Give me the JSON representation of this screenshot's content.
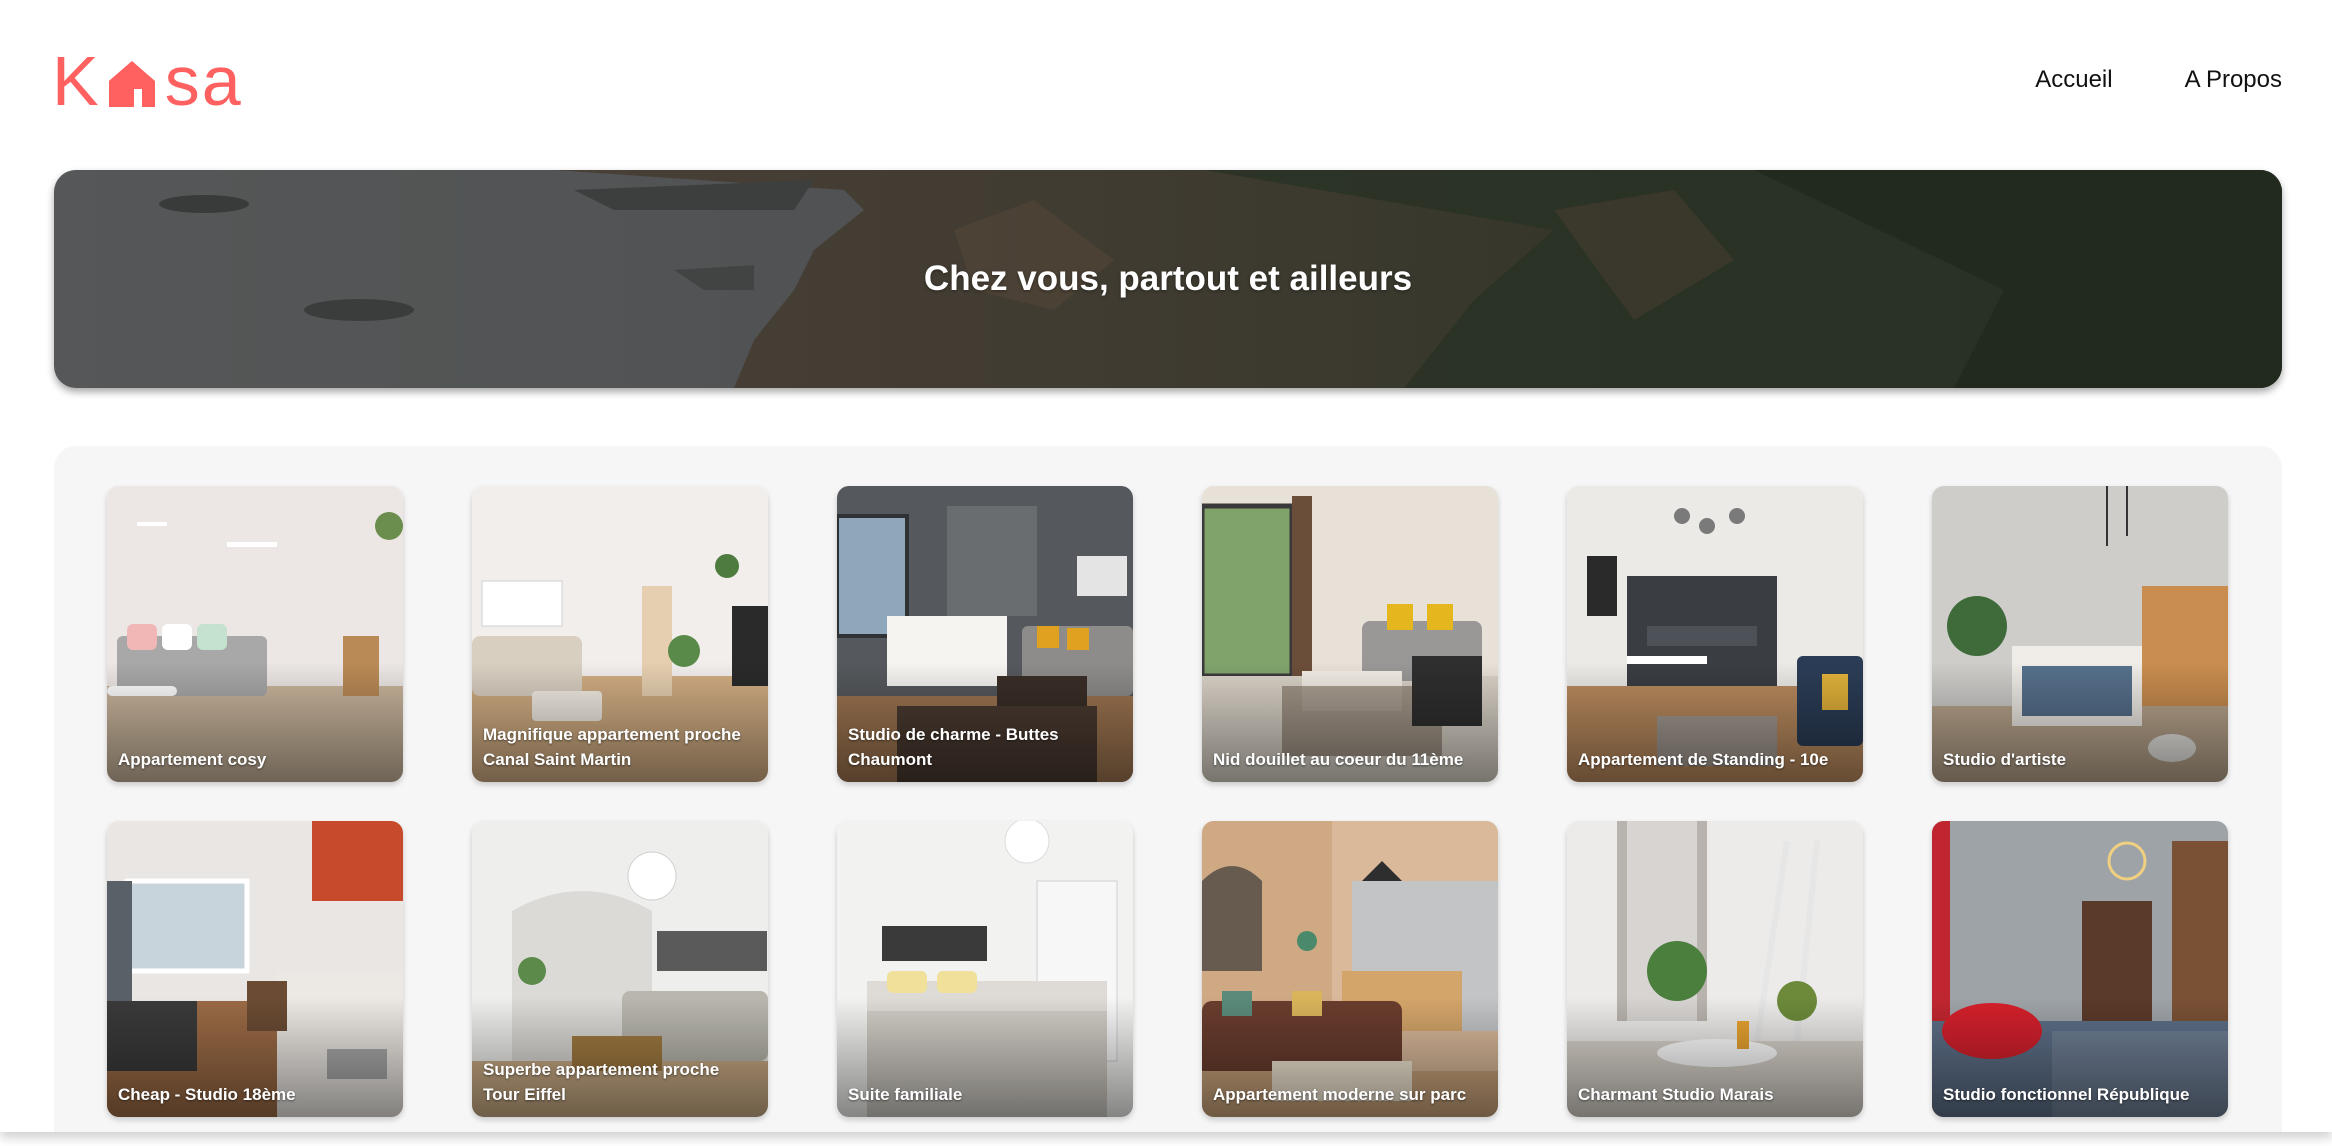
{
  "header": {
    "logo_text_left": "K",
    "logo_text_right": "sa",
    "brand_color": "#FF6060",
    "logo_icon": "house-icon"
  },
  "nav": {
    "items": [
      {
        "label": "Accueil"
      },
      {
        "label": "A Propos"
      }
    ]
  },
  "banner": {
    "title": "Chez vous, partout et ailleurs"
  },
  "gallery": {
    "cards": [
      {
        "title": "Appartement cosy",
        "theme": "white-pastel"
      },
      {
        "title": "Magnifique appartement proche Canal Saint Martin",
        "theme": "bright-beige"
      },
      {
        "title": "Studio de charme - Buttes Chaumont",
        "theme": "dark-grey-orange"
      },
      {
        "title": "Nid douillet au coeur du 11ème",
        "theme": "beige-window"
      },
      {
        "title": "Appartement de Standing - 10e",
        "theme": "white-dark-kitchen"
      },
      {
        "title": "Studio d'artiste",
        "theme": "concrete-wood"
      },
      {
        "title": "Cheap - Studio 18ème",
        "theme": "kitchen-red"
      },
      {
        "title": "Superbe appartement proche Tour Eiffel",
        "theme": "white-arch"
      },
      {
        "title": "Suite familiale",
        "theme": "white-bedroom"
      },
      {
        "title": "Appartement moderne sur parc",
        "theme": "brick-brown"
      },
      {
        "title": "Charmant Studio Marais",
        "theme": "white-plants"
      },
      {
        "title": "Studio fonctionnel République",
        "theme": "grey-bed-red"
      }
    ]
  }
}
